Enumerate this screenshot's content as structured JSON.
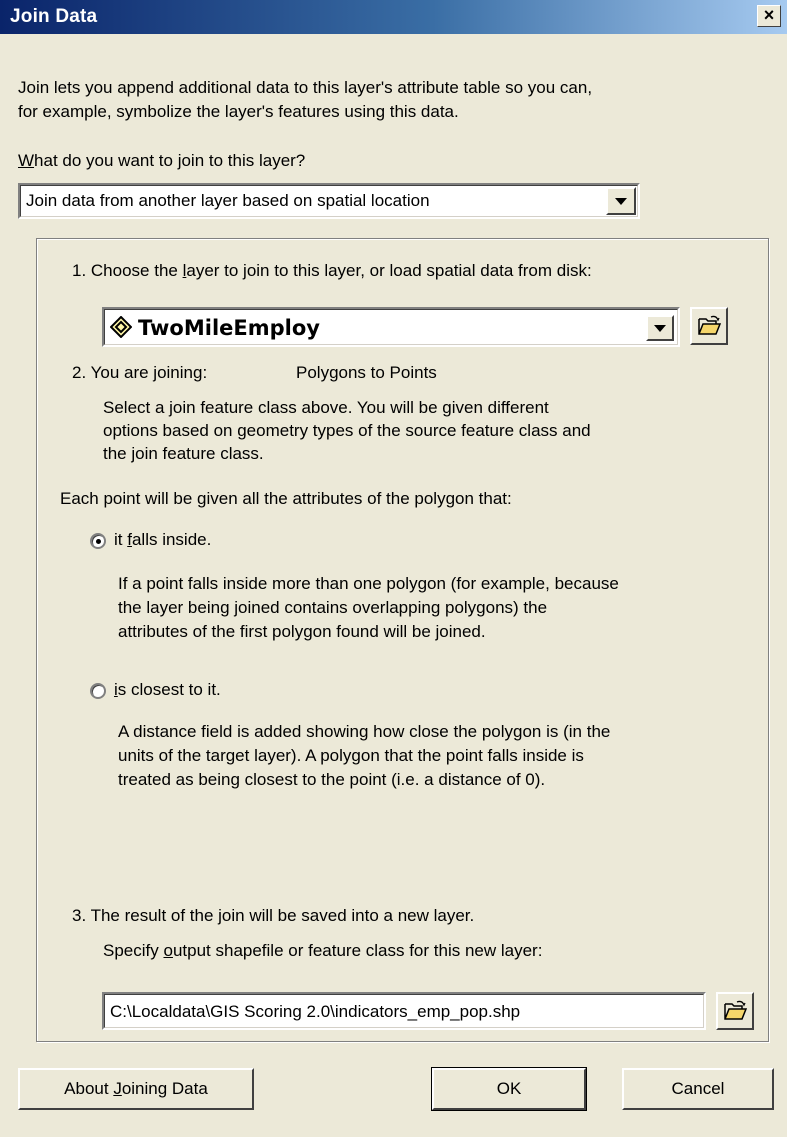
{
  "window": {
    "title": "Join Data",
    "close_label": "×"
  },
  "intro": {
    "line1": "Join lets you append additional data to this layer's attribute table so you can,",
    "line2": "for example, symbolize the layer's features using this data."
  },
  "question": {
    "prefix": "W",
    "rest": "hat do you want to join to this layer?"
  },
  "join_type": {
    "selected": "Join data from another layer based on spatial location"
  },
  "step1": {
    "label_a": "1.  Choose the ",
    "label_u": "l",
    "label_b": "ayer to join to this layer, or load spatial data from disk:",
    "layer_selected": "TwoMileEmploy"
  },
  "step2": {
    "label": "2.  You are joining:",
    "value": "Polygons to Points",
    "desc1": "Select a join feature class above.  You will be given different",
    "desc2": "options based on geometry types of the source feature class and",
    "desc3": "the join feature class.",
    "intro": "Each point will be given all the attributes of the polygon that:",
    "option1": {
      "label_a": "it ",
      "label_u": "f",
      "label_b": "alls inside.",
      "checked": true,
      "desc1": "If a point falls inside more than one polygon (for example, because",
      "desc2": "the layer being joined contains overlapping polygons) the",
      "desc3": "attributes of the first polygon found will be joined."
    },
    "option2": {
      "label_u": "i",
      "label_b": "s closest to it.",
      "checked": false,
      "desc1": "A distance field is added showing how close the polygon is (in the",
      "desc2": "units of the target layer). A polygon that the point falls inside is",
      "desc3": "treated as being closest to the point (i.e. a distance of 0)."
    }
  },
  "step3": {
    "label": "3.  The result of the join will be saved into a new layer.",
    "spec_a": "Specify ",
    "spec_u": "o",
    "spec_b": "utput shapefile or feature class for this new layer:",
    "output_path": "C:\\Localdata\\GIS Scoring 2.0\\indicators_emp_pop.shp"
  },
  "buttons": {
    "about_a": "About ",
    "about_u": "J",
    "about_b": "oining Data",
    "ok": "OK",
    "cancel": "Cancel"
  },
  "icons": [
    "close-icon",
    "dropdown-arrow-icon",
    "layer-polygon-icon",
    "open-folder-icon",
    "radio-icon"
  ]
}
